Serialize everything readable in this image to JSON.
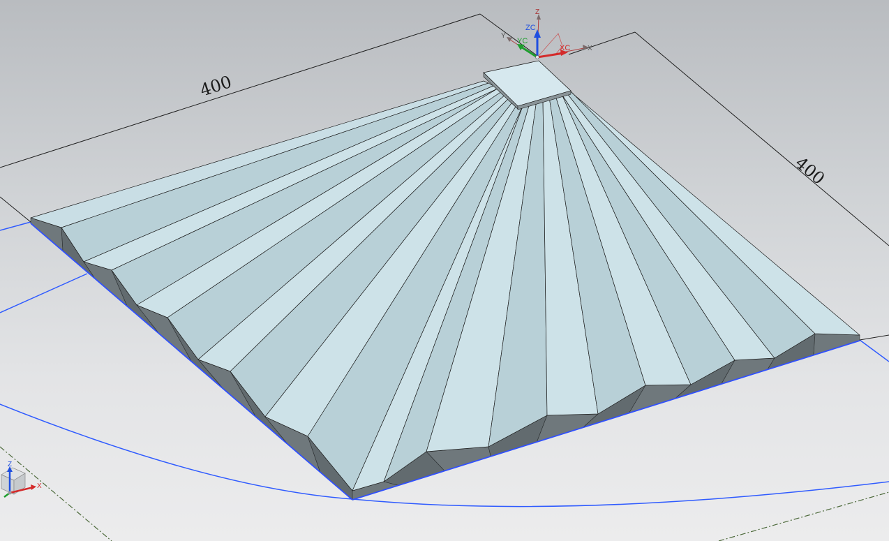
{
  "viewport": {
    "background_top": "#b9bcc0",
    "background_bottom": "#ececed"
  },
  "dimensions": {
    "length_label": "400",
    "width_label": "400"
  },
  "wcs_triad": {
    "z_label": "Z",
    "zc_label": "ZC",
    "yc_label": "YC",
    "xc_label": "XC",
    "x_label": "X",
    "y_label": "Y"
  },
  "view_triad": {
    "z_label": "Z",
    "x_label": "X"
  },
  "colors": {
    "face_light": "#cde2e8",
    "face_mid": "#b8d0d7",
    "side_dark": "#6e777b",
    "edge_highlight": "#3050ff",
    "datum_line": "#4d6a3b",
    "dimension_line": "#1f1f1f",
    "z_axis": "#1f4fe0",
    "y_axis": "#1e9e2e",
    "x_axis": "#d42b2b"
  },
  "model": {
    "pleat_count": 12
  }
}
